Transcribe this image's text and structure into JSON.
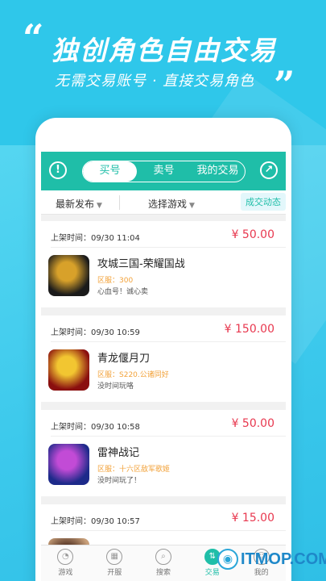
{
  "promo": {
    "quote_open": "“",
    "quote_close": "”",
    "headline": "独创角色自由交易",
    "subline": "无需交易账号 · 直接交易角色"
  },
  "topbar": {
    "left_icon": "info-icon",
    "right_icon": "arrow-up-right-icon",
    "tabs": [
      "买号",
      "卖号",
      "我的交易"
    ],
    "active_tab": 0
  },
  "filters": {
    "sort": "最新发布",
    "game": "选择游戏",
    "deals": "成交动态"
  },
  "listings": [
    {
      "time_label": "上架时间：09/30 11:04",
      "price": "¥ 50.00",
      "name": "攻城三国-荣耀国战",
      "area": "区服：300",
      "desc": "心血号！诚心卖",
      "thumb_colors": [
        "#1b1b1b",
        "#d8a12a"
      ]
    },
    {
      "time_label": "上架时间：09/30 10:59",
      "price": "¥ 150.00",
      "name": "青龙偃月刀",
      "area": "区服：S220.公诸同好",
      "desc": "没时间玩咯",
      "thumb_colors": [
        "#8a0f0f",
        "#f2c631"
      ]
    },
    {
      "time_label": "上架时间：09/30 10:58",
      "price": "¥ 50.00",
      "name": "雷神战记",
      "area": "区服：十六区敌军歌姬",
      "desc": "没时间玩了！",
      "thumb_colors": [
        "#1d2a8a",
        "#c24bd6"
      ]
    },
    {
      "time_label": "上架时间：09/30 10:57",
      "price": "¥ 15.00",
      "name": "",
      "area": "",
      "desc": "",
      "thumb_colors": [
        "#c9a07a",
        "#5b3a2a"
      ]
    }
  ],
  "tabbar": [
    {
      "label": "游戏",
      "icon": "pacman-icon",
      "glyph": "◔"
    },
    {
      "label": "开服",
      "icon": "server-icon",
      "glyph": "▦"
    },
    {
      "label": "搜索",
      "icon": "search-icon",
      "glyph": "⌕"
    },
    {
      "label": "交易",
      "icon": "swap-icon",
      "glyph": "⇅"
    },
    {
      "label": "我的",
      "icon": "user-icon",
      "glyph": "☺"
    }
  ],
  "active_tabbar": 3,
  "watermark": {
    "logo": "◉",
    "text": "ITMOP.COM"
  },
  "colors": {
    "brand": "#1fbea8",
    "price": "#e8384f",
    "area": "#f2a23a",
    "bg": "#2fc7ea"
  }
}
